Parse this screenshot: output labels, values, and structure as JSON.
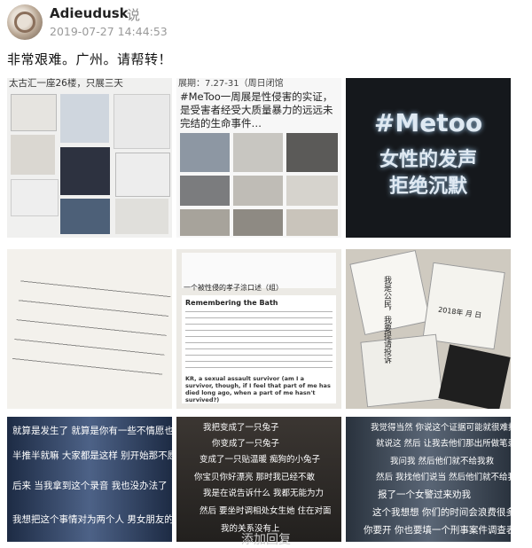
{
  "post": {
    "username": "Adieudusk",
    "said_label": "说",
    "timestamp": "2019-07-27 14:44:53",
    "text": "非常艰难。广州。请帮转！"
  },
  "images": {
    "tile1": {
      "caption": "太古汇一座26楼，只展三天"
    },
    "tile2": {
      "top_caption": "展期：7.27-31（周日闭馆",
      "text": "#MeToo一周展是性侵害的实证，是受害者经受大质量暴力的远远未完结的生命事件…"
    },
    "tile3": {
      "line1": "#Metoo",
      "line2": "女性的发声",
      "line3": "拒绝沉默"
    },
    "tile5": {
      "heading": "Remembering the Bath",
      "signature": "KR, a sexual assault survivor (am I a survivor, though, if I feel that part of me has died long ago, when a part of me hasn't survived?)",
      "quote": "一个被性侵的孝子涂口述（组）"
    },
    "tile6": {
      "note": "我是公民，我要提请投诉",
      "date": "2018年 月 日"
    },
    "tile7": {
      "lines": [
        "就算是发生了 就算是你有一些不情愿也没关系",
        "半推半就嘛 大家都是这样 别开始那不愿意 慢慢就愿意了",
        "后来 当我拿到这个录音 我也没办法了",
        "我想把这个事情对为两个人 男女朋友的情感纠"
      ]
    },
    "tile8": {
      "lines": [
        "我把变成了一只兔子",
        "你变成了一只兔子",
        "变成了一只贴温暖 痴狗的小兔子",
        "你宝贝你好漂亮 那时我已经不敢",
        "我是在说告诉什么 我都无能为力",
        "然后 要坐时调相处女生她 住在对面",
        "我的关系没有上"
      ]
    },
    "tile9": {
      "lines": [
        "我觉得当然 你说这个证据可能就很难找了",
        "就说这 然后 让我去他们那出所做笔录",
        "我问我 然后他们就不给我救",
        "然后 我找他们说当 然后他们就不给我救",
        "报了一个女警过来劝我",
        "这个我想想 你们的时间会浪费很多",
        "你要开 你也要填一个刑事案件调查表"
      ]
    }
  },
  "footer_hint": "添加回复"
}
